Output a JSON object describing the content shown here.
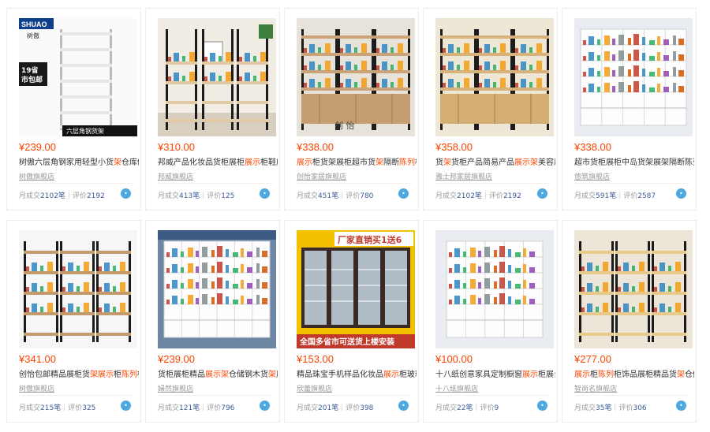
{
  "products": [
    {
      "price": "¥239.00",
      "title": [
        {
          "t": "树傲六层角钢家用轻型小货"
        },
        {
          "t": "架",
          "hl": true
        },
        {
          "t": "仓库储物"
        }
      ],
      "shop": "树傲旗舰店",
      "sales_label": "月成交",
      "sales": "2102笔",
      "reviews_label": "评价",
      "reviews": "2192",
      "img": {
        "style": "shelf-white",
        "logo": "SHUAO",
        "logo_sub": "树傲",
        "promo": "19省市包邮",
        "caption": "六层角钢货架"
      }
    },
    {
      "price": "¥310.00",
      "title": [
        {
          "t": "邦威产品化妆品货柜展柜"
        },
        {
          "t": "展示",
          "hl": true
        },
        {
          "t": "柜鞋店货"
        }
      ],
      "shop": "邦威旗舰店",
      "sales_label": "月成交",
      "sales": "413笔",
      "reviews_label": "评价",
      "reviews": "125",
      "img": {
        "style": "room-light"
      }
    },
    {
      "price": "¥338.00",
      "title": [
        {
          "t": "展示",
          "hl": true
        },
        {
          "t": "柜货架展柜超市货"
        },
        {
          "t": "架",
          "hl": true
        },
        {
          "t": "隔断"
        },
        {
          "t": "陈列",
          "hl": true
        },
        {
          "t": "柜精"
        }
      ],
      "shop": "创怡家居旗舰店",
      "sales_label": "月成交",
      "sales": "451笔",
      "reviews_label": "评价",
      "reviews": "780",
      "img": {
        "style": "shelf-dark",
        "watermark": "创 怡"
      }
    },
    {
      "price": "¥358.00",
      "title": [
        {
          "t": "货"
        },
        {
          "t": "架",
          "hl": true
        },
        {
          "t": "货柜产品简易产品"
        },
        {
          "t": "展示架",
          "hl": true
        },
        {
          "t": "美容展柜"
        }
      ],
      "shop": "雅士邦家居旗舰店",
      "sales_label": "月成交",
      "sales": "2102笔",
      "reviews_label": "评价",
      "reviews": "2192",
      "img": {
        "style": "shelf-wood"
      }
    },
    {
      "price": "¥338.00",
      "title": [
        {
          "t": "超市货柜展柜中岛货架展架隔断陈列柜"
        }
      ],
      "shop": "悠筑旗舰店",
      "sales_label": "月成交",
      "sales": "591笔",
      "reviews_label": "评价",
      "reviews": "2587",
      "img": {
        "style": "cabinet-white"
      }
    },
    {
      "price": "¥341.00",
      "title": [
        {
          "t": "创怡包邮精品展柜货"
        },
        {
          "t": "架展示",
          "hl": true
        },
        {
          "t": "柜"
        },
        {
          "t": "陈列",
          "hl": true
        },
        {
          "t": "柜化"
        }
      ],
      "shop": "树傲旗舰店",
      "sales_label": "月成交",
      "sales": "215笔",
      "reviews_label": "评价",
      "reviews": "325",
      "img": {
        "style": "shelf-dark-white"
      }
    },
    {
      "price": "¥239.00",
      "title": [
        {
          "t": "货柜展柜精品"
        },
        {
          "t": "展示架",
          "hl": true
        },
        {
          "t": "仓储钢木货"
        },
        {
          "t": "架",
          "hl": true
        },
        {
          "t": "屏风"
        }
      ],
      "shop": "婦然旗舰店",
      "sales_label": "月成交",
      "sales": "121笔",
      "reviews_label": "评价",
      "reviews": "796",
      "img": {
        "style": "cabinet-logo"
      }
    },
    {
      "price": "¥153.00",
      "title": [
        {
          "t": "精品珠宝手机样品化妆品"
        },
        {
          "t": "展示",
          "hl": true
        },
        {
          "t": "柜玻璃柜"
        }
      ],
      "shop": "欣蕾旗舰店",
      "sales_label": "月成交",
      "sales": "201笔",
      "reviews_label": "评价",
      "reviews": "398",
      "img": {
        "style": "glass-promo",
        "promo_top": "厂家直销买1送6",
        "promo_bottom": "全国多省市可送货上楼安装"
      }
    },
    {
      "price": "¥100.00",
      "title": [
        {
          "t": "十八纸创意家具定制橱窗"
        },
        {
          "t": "展示",
          "hl": true
        },
        {
          "t": "柜展台展"
        }
      ],
      "shop": "十八纸旗舰店",
      "sales_label": "月成交",
      "sales": "22笔",
      "reviews_label": "评价",
      "reviews": "9",
      "img": {
        "style": "cabinet-grid"
      }
    },
    {
      "price": "¥277.00",
      "title": [
        {
          "t": "展示",
          "hl": true
        },
        {
          "t": "柜"
        },
        {
          "t": "陈列",
          "hl": true
        },
        {
          "t": "柜饰品展柜精品货"
        },
        {
          "t": "架",
          "hl": true
        },
        {
          "t": "仓储家"
        }
      ],
      "shop": "智尚名旗舰店",
      "sales_label": "月成交",
      "sales": "35笔",
      "reviews_label": "评价",
      "reviews": "306",
      "img": {
        "style": "shelf-lit"
      }
    }
  ],
  "colors": {
    "price": "#ff4400",
    "highlight": "#ff4400",
    "stat_num": "#3d5d96",
    "muted": "#999999",
    "wangwang": "#4fa8e0"
  },
  "icons": {
    "chat": "wangwang-chat-icon"
  }
}
